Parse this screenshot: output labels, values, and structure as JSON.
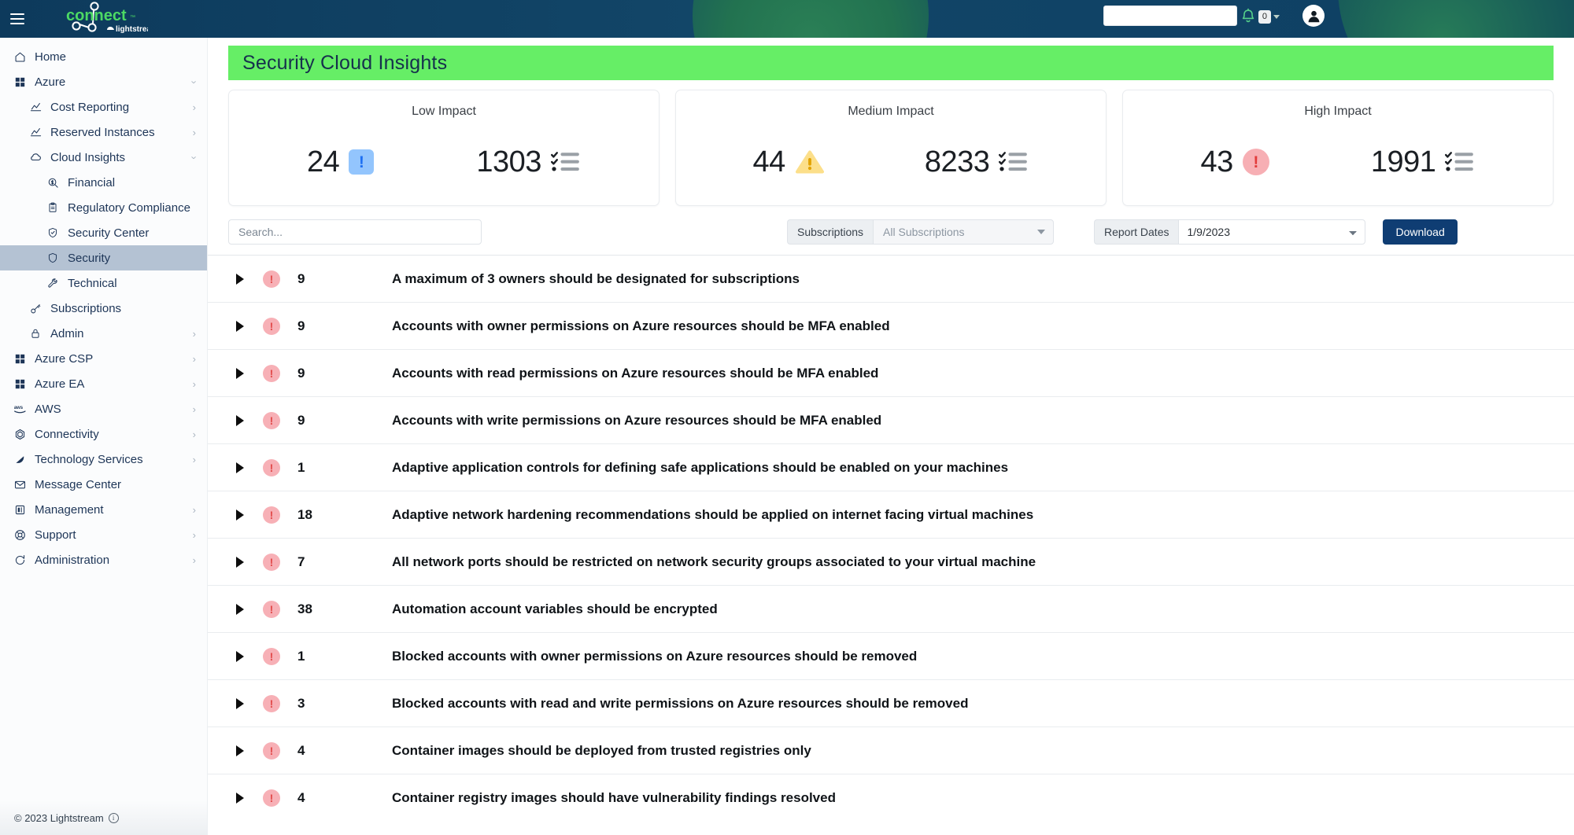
{
  "header": {
    "menu_icon": "hamburger-icon",
    "logo_text": "connect",
    "logo_tm": "™",
    "logo_sub": "lightstream",
    "search_value": "",
    "search_placeholder": "",
    "bell_icon": "bell-icon",
    "notification_count": "0",
    "caret_icon": "chevron-down-icon",
    "avatar_icon": "user-avatar-icon"
  },
  "sidebar": {
    "items": [
      {
        "label": "Home",
        "icon": "home-icon",
        "level": 0,
        "chevron": "",
        "selected": false
      },
      {
        "label": "Azure",
        "icon": "grid-icon",
        "level": 0,
        "chevron": "down",
        "selected": false
      },
      {
        "label": "Cost Reporting",
        "icon": "chart-icon",
        "level": 1,
        "chevron": "right",
        "selected": false
      },
      {
        "label": "Reserved Instances",
        "icon": "chart-icon",
        "level": 1,
        "chevron": "right",
        "selected": false
      },
      {
        "label": "Cloud Insights",
        "icon": "cloud-icon",
        "level": 1,
        "chevron": "down",
        "selected": false
      },
      {
        "label": "Financial",
        "icon": "money-search-icon",
        "level": 2,
        "chevron": "",
        "selected": false
      },
      {
        "label": "Regulatory Compliance",
        "icon": "clipboard-icon",
        "level": 2,
        "chevron": "",
        "selected": false
      },
      {
        "label": "Security Center",
        "icon": "shield-check-icon",
        "level": 2,
        "chevron": "",
        "selected": false
      },
      {
        "label": "Security",
        "icon": "shield-icon",
        "level": 2,
        "chevron": "",
        "selected": true
      },
      {
        "label": "Technical",
        "icon": "wrench-icon",
        "level": 2,
        "chevron": "",
        "selected": false
      },
      {
        "label": "Subscriptions",
        "icon": "key-icon",
        "level": 1,
        "chevron": "",
        "selected": false
      },
      {
        "label": "Admin",
        "icon": "lock-icon",
        "level": 1,
        "chevron": "right",
        "selected": false
      },
      {
        "label": "Azure CSP",
        "icon": "grid-icon",
        "level": 0,
        "chevron": "right",
        "selected": false
      },
      {
        "label": "Azure EA",
        "icon": "grid-icon",
        "level": 0,
        "chevron": "right",
        "selected": false
      },
      {
        "label": "AWS",
        "icon": "aws-icon",
        "level": 0,
        "chevron": "right",
        "selected": false
      },
      {
        "label": "Connectivity",
        "icon": "hexagon-icon",
        "level": 0,
        "chevron": "right",
        "selected": false
      },
      {
        "label": "Technology Services",
        "icon": "triangle-icon",
        "level": 0,
        "chevron": "right",
        "selected": false
      },
      {
        "label": "Message Center",
        "icon": "envelope-icon",
        "level": 0,
        "chevron": "",
        "selected": false
      },
      {
        "label": "Management",
        "icon": "server-icon",
        "level": 0,
        "chevron": "right",
        "selected": false
      },
      {
        "label": "Support",
        "icon": "lifebuoy-icon",
        "level": 0,
        "chevron": "right",
        "selected": false
      },
      {
        "label": "Administration",
        "icon": "refresh-icon",
        "level": 0,
        "chevron": "right",
        "selected": false
      }
    ],
    "footer": {
      "copyright": "© 2023 Lightstream",
      "info_icon": "info-icon"
    }
  },
  "page": {
    "title": "Security Cloud Insights",
    "banner_color": "#66ee66",
    "banner_text_color": "#16304d"
  },
  "cards": [
    {
      "title": "Low Impact",
      "count": "24",
      "badge_icon": "exclamation-square-icon",
      "badge_shape": "square",
      "badge_bg": "#93c5fd",
      "badge_fg": "#1d6ff2",
      "total": "1303",
      "list_icon": "checklist-icon"
    },
    {
      "title": "Medium Impact",
      "count": "44",
      "badge_icon": "warning-triangle-icon",
      "badge_shape": "triangle",
      "badge_bg": "#fcdf8a",
      "badge_fg": "#e2a300",
      "total": "8233",
      "list_icon": "checklist-icon"
    },
    {
      "title": "High Impact",
      "count": "43",
      "badge_icon": "exclamation-circle-icon",
      "badge_shape": "circle",
      "badge_bg": "#f7afb4",
      "badge_fg": "#e23a3a",
      "total": "1991",
      "list_icon": "checklist-icon"
    }
  ],
  "toolbar": {
    "search_value": "",
    "search_placeholder": "Search...",
    "subscriptions_label": "Subscriptions",
    "subscriptions_value": "All Subscriptions",
    "subscriptions_caret": "chevron-down-icon",
    "report_dates_label": "Report Dates",
    "report_date_value": "1/9/2023",
    "report_date_options": [
      "1/9/2023"
    ],
    "download_label": "Download"
  },
  "findings": {
    "rows": [
      {
        "count": "9",
        "severity_icon": "exclamation-circle-icon",
        "title": "A maximum of 3 owners should be designated for subscriptions"
      },
      {
        "count": "9",
        "severity_icon": "exclamation-circle-icon",
        "title": "Accounts with owner permissions on Azure resources should be MFA enabled"
      },
      {
        "count": "9",
        "severity_icon": "exclamation-circle-icon",
        "title": "Accounts with read permissions on Azure resources should be MFA enabled"
      },
      {
        "count": "9",
        "severity_icon": "exclamation-circle-icon",
        "title": "Accounts with write permissions on Azure resources should be MFA enabled"
      },
      {
        "count": "1",
        "severity_icon": "exclamation-circle-icon",
        "title": "Adaptive application controls for defining safe applications should be enabled on your machines"
      },
      {
        "count": "18",
        "severity_icon": "exclamation-circle-icon",
        "title": "Adaptive network hardening recommendations should be applied on internet facing virtual machines"
      },
      {
        "count": "7",
        "severity_icon": "exclamation-circle-icon",
        "title": "All network ports should be restricted on network security groups associated to your virtual machine"
      },
      {
        "count": "38",
        "severity_icon": "exclamation-circle-icon",
        "title": "Automation account variables should be encrypted"
      },
      {
        "count": "1",
        "severity_icon": "exclamation-circle-icon",
        "title": "Blocked accounts with owner permissions on Azure resources should be removed"
      },
      {
        "count": "3",
        "severity_icon": "exclamation-circle-icon",
        "title": "Blocked accounts with read and write permissions on Azure resources should be removed"
      },
      {
        "count": "4",
        "severity_icon": "exclamation-circle-icon",
        "title": "Container images should be deployed from trusted registries only"
      },
      {
        "count": "4",
        "severity_icon": "exclamation-circle-icon",
        "title": "Container registry images should have vulnerability findings resolved"
      }
    ],
    "expand_icon": "expand-triangle-icon"
  }
}
